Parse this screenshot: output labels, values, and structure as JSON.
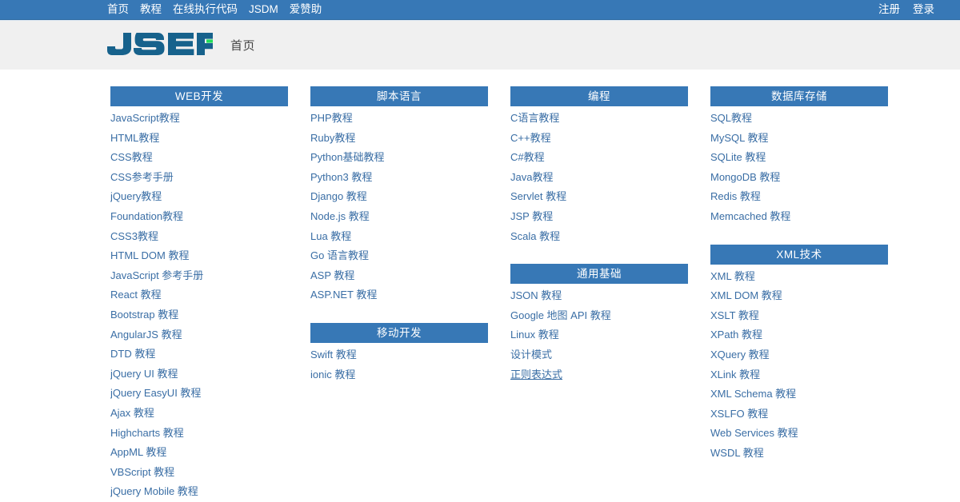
{
  "topnav": {
    "background": "#3778b6",
    "left_links": [
      {
        "label": "首页"
      },
      {
        "label": "教程"
      },
      {
        "label": "在线执行代码"
      },
      {
        "label": "JSDM"
      },
      {
        "label": "爱赞助"
      }
    ],
    "right_links": [
      {
        "label": "注册"
      },
      {
        "label": "登录"
      }
    ]
  },
  "header": {
    "logo_text": "JSER",
    "logo_color": "#17628c",
    "logo_accent_color": "#22dd5a",
    "breadcrumb": "首页"
  },
  "content": {
    "link_color": "#3a6ea5",
    "columns": [
      {
        "sections": [
          {
            "title": "WEB开发",
            "links": [
              {
                "label": "JavaScript教程"
              },
              {
                "label": "HTML教程"
              },
              {
                "label": "CSS教程"
              },
              {
                "label": "CSS参考手册"
              },
              {
                "label": "jQuery教程"
              },
              {
                "label": "Foundation教程"
              },
              {
                "label": "CSS3教程"
              },
              {
                "label": "HTML DOM 教程"
              },
              {
                "label": "JavaScript 参考手册"
              },
              {
                "label": "React 教程"
              },
              {
                "label": "Bootstrap 教程"
              },
              {
                "label": "AngularJS 教程"
              },
              {
                "label": "DTD 教程"
              },
              {
                "label": "jQuery UI 教程"
              },
              {
                "label": "jQuery EasyUI 教程"
              },
              {
                "label": "Ajax 教程"
              },
              {
                "label": "Highcharts 教程"
              },
              {
                "label": "AppML 教程"
              },
              {
                "label": "VBScript 教程"
              },
              {
                "label": "jQuery Mobile 教程"
              }
            ]
          }
        ]
      },
      {
        "sections": [
          {
            "title": "脚本语言",
            "links": [
              {
                "label": "PHP教程"
              },
              {
                "label": "Ruby教程"
              },
              {
                "label": "Python基础教程"
              },
              {
                "label": "Python3 教程"
              },
              {
                "label": "Django 教程"
              },
              {
                "label": "Node.js 教程"
              },
              {
                "label": "Lua 教程"
              },
              {
                "label": "Go 语言教程"
              },
              {
                "label": "ASP 教程"
              },
              {
                "label": "ASP.NET 教程"
              }
            ]
          },
          {
            "title": "移动开发",
            "links": [
              {
                "label": "Swift 教程"
              },
              {
                "label": "ionic 教程"
              }
            ]
          }
        ]
      },
      {
        "sections": [
          {
            "title": "编程",
            "links": [
              {
                "label": "C语言教程"
              },
              {
                "label": "C++教程"
              },
              {
                "label": "C#教程"
              },
              {
                "label": "Java教程"
              },
              {
                "label": "Servlet 教程"
              },
              {
                "label": "JSP 教程"
              },
              {
                "label": "Scala 教程"
              }
            ]
          },
          {
            "title": "通用基础",
            "links": [
              {
                "label": "JSON 教程"
              },
              {
                "label": "Google 地图 API 教程"
              },
              {
                "label": "Linux 教程"
              },
              {
                "label": "设计模式"
              },
              {
                "label": "正则表达式",
                "hovered": true
              }
            ]
          }
        ]
      },
      {
        "sections": [
          {
            "title": "数据库存储",
            "links": [
              {
                "label": "SQL教程"
              },
              {
                "label": "MySQL 教程"
              },
              {
                "label": "SQLite 教程"
              },
              {
                "label": "MongoDB 教程"
              },
              {
                "label": "Redis 教程"
              },
              {
                "label": "Memcached 教程"
              }
            ]
          },
          {
            "title": "XML技术",
            "links": [
              {
                "label": "XML 教程"
              },
              {
                "label": "XML DOM 教程"
              },
              {
                "label": "XSLT 教程"
              },
              {
                "label": "XPath 教程"
              },
              {
                "label": "XQuery 教程"
              },
              {
                "label": "XLink 教程"
              },
              {
                "label": "XML Schema 教程"
              },
              {
                "label": "XSLFO 教程"
              },
              {
                "label": "Web Services 教程"
              },
              {
                "label": "WSDL 教程"
              }
            ]
          }
        ]
      }
    ]
  }
}
